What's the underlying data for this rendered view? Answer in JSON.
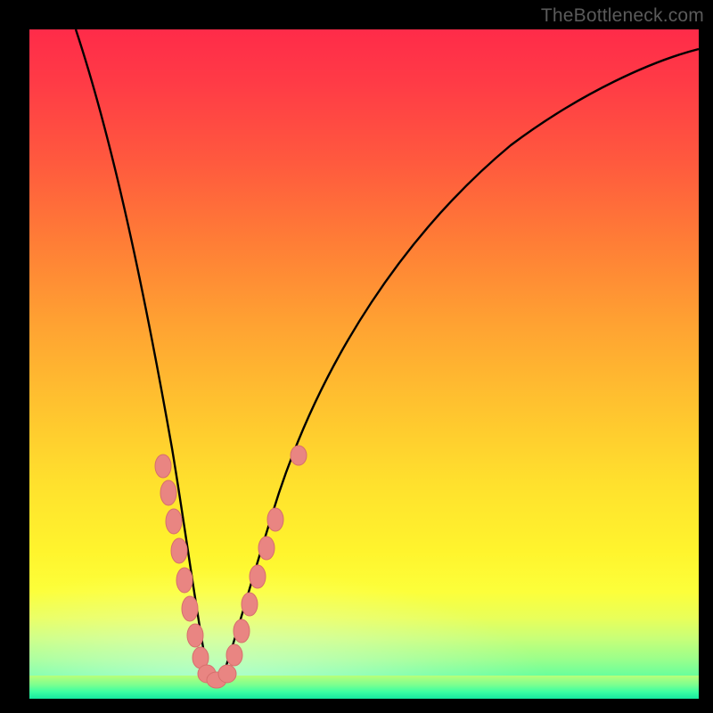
{
  "watermark": "TheBottleneck.com",
  "colors": {
    "curve_stroke": "#000000",
    "marker_fill": "#e98582",
    "marker_stroke": "#d76f6d"
  },
  "chart_data": {
    "type": "line",
    "title": "",
    "xlabel": "",
    "ylabel": "",
    "xlim": [
      0,
      100
    ],
    "ylim": [
      0,
      100
    ],
    "series": [
      {
        "name": "bottleneck-curve",
        "x": [
          7,
          10,
          13,
          16,
          18,
          20,
          22,
          24,
          25,
          26,
          27,
          28,
          30,
          34,
          38,
          44,
          52,
          62,
          74,
          88,
          100
        ],
        "y": [
          100,
          85,
          70,
          55,
          42,
          30,
          20,
          11,
          6,
          3,
          2,
          3,
          8,
          17,
          28,
          40,
          53,
          66,
          78,
          87,
          92
        ]
      }
    ],
    "markers": {
      "name": "highlighted-points",
      "x": [
        19.5,
        20.5,
        21.5,
        22.3,
        23.0,
        23.8,
        24.5,
        25.2,
        26.0,
        26.8,
        27.5,
        28.3,
        29.2,
        30.0,
        31.0,
        32.0,
        33.0,
        36.5
      ],
      "y": [
        35,
        30,
        25,
        20,
        16,
        12,
        9,
        6,
        4,
        3,
        3,
        4,
        6,
        9,
        12,
        15,
        18,
        26
      ]
    }
  }
}
